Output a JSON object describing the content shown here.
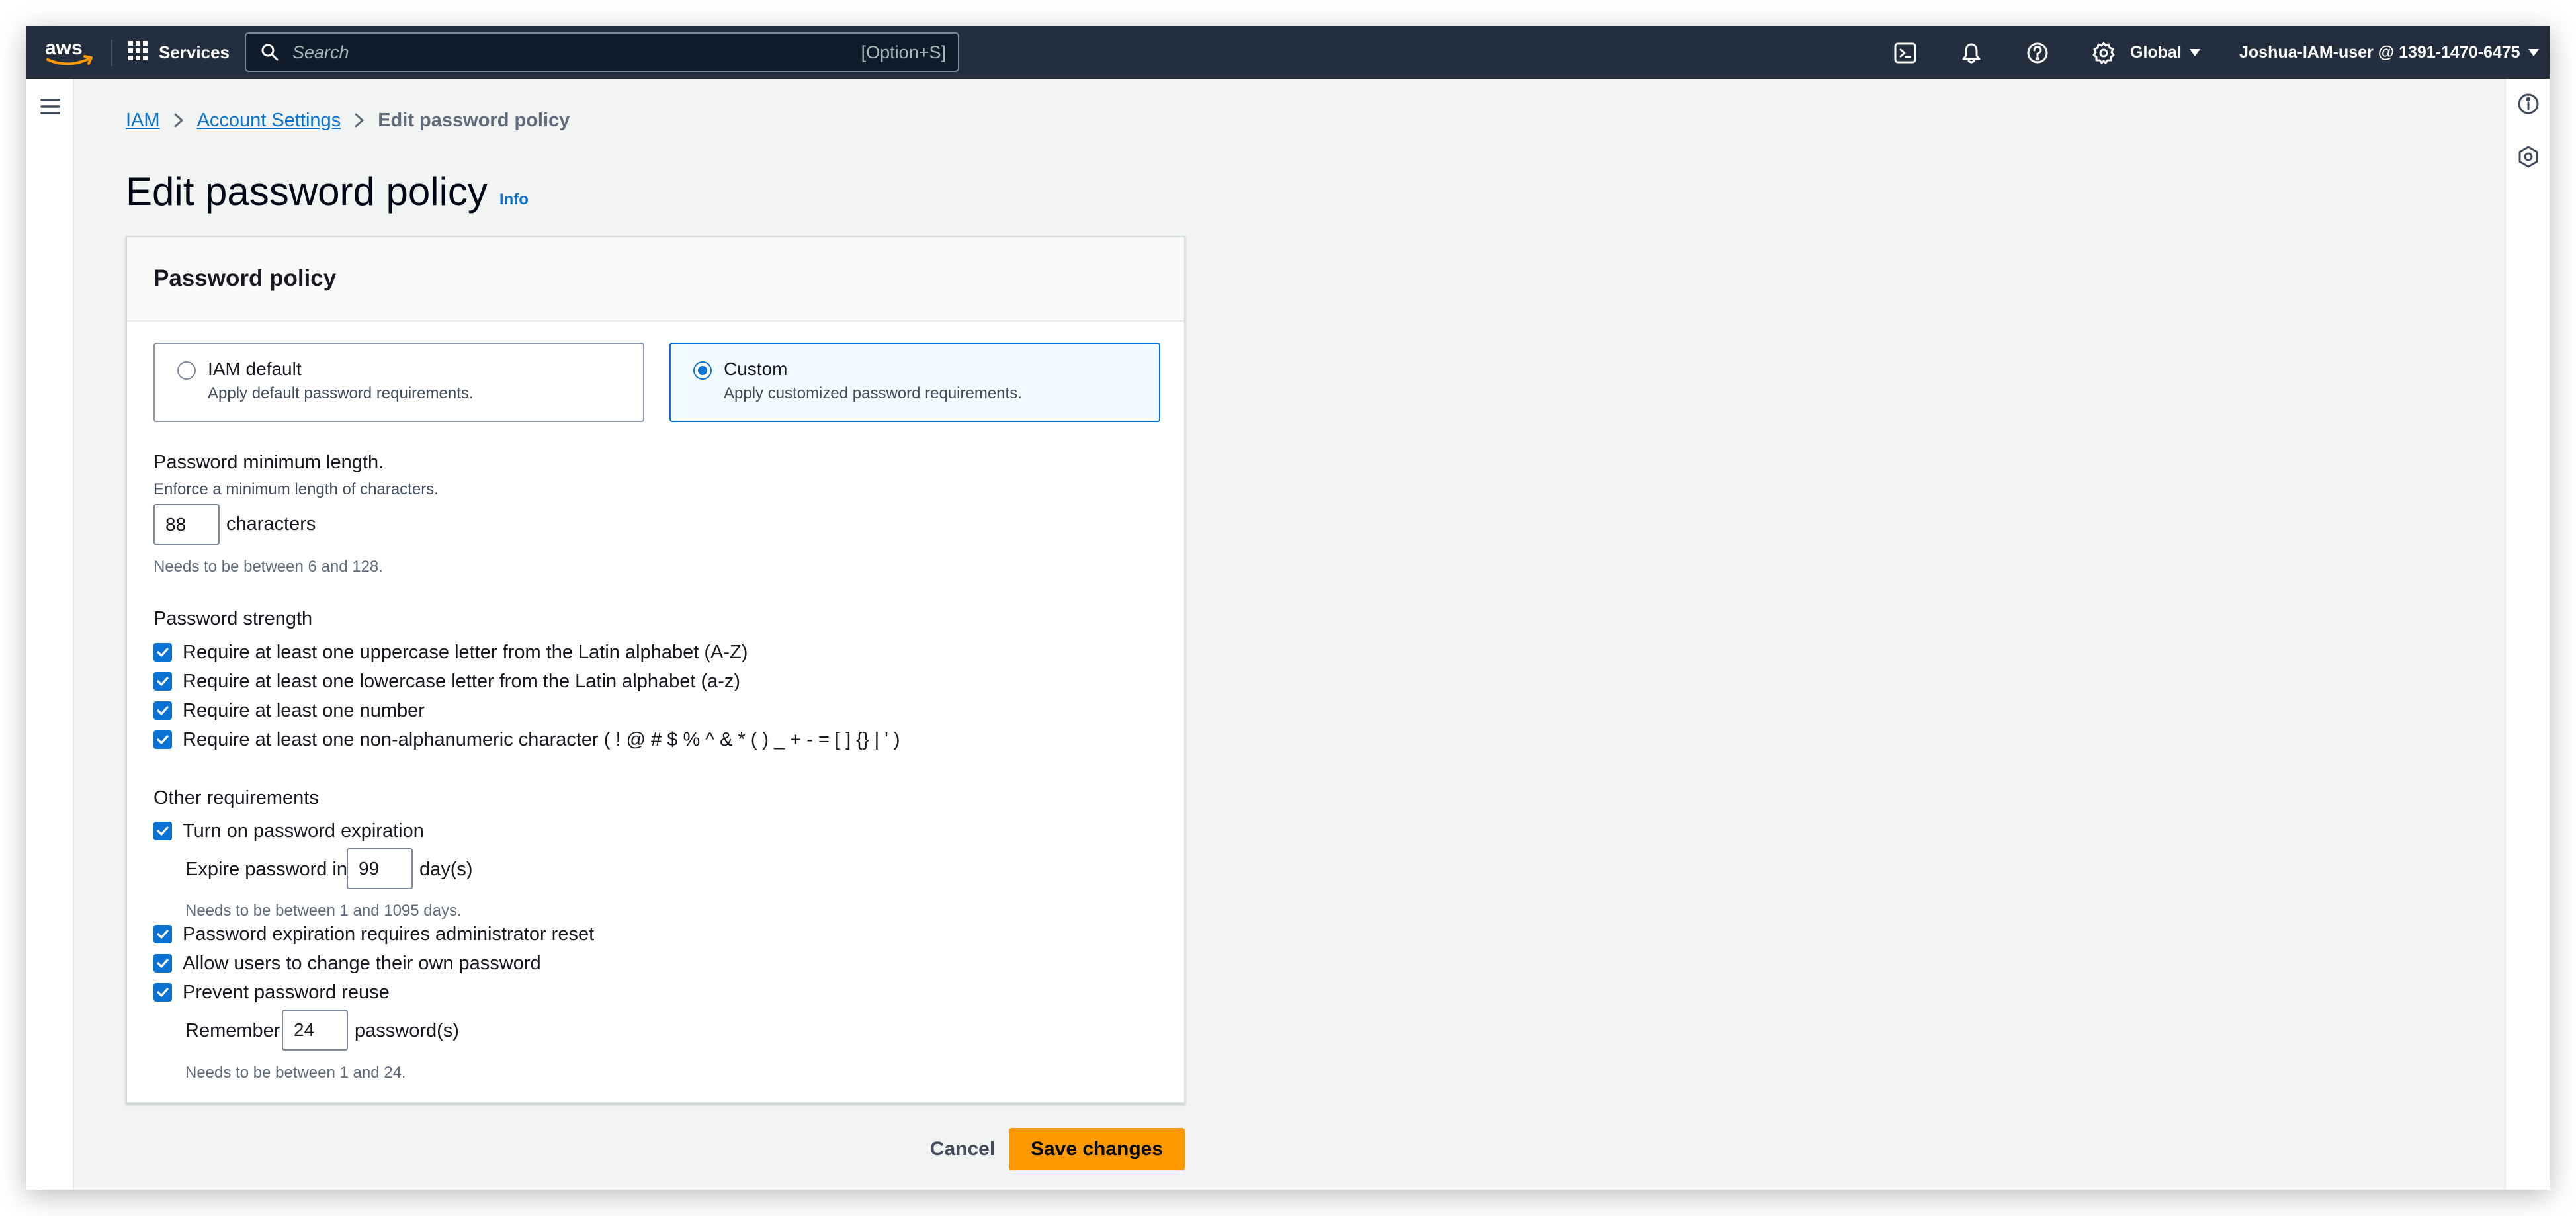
{
  "topnav": {
    "logo_text": "aws",
    "services_label": "Services",
    "search": {
      "placeholder": "Search",
      "shortcut": "[Option+S]"
    },
    "icons": [
      "cloudshell-icon",
      "bell-icon",
      "help-icon",
      "settings-icon"
    ],
    "region_label": "Global",
    "account_label": "Joshua-IAM-user @ 1391-1470-6475"
  },
  "breadcrumb": {
    "items": [
      "IAM",
      "Account Settings"
    ],
    "current": "Edit password policy"
  },
  "page": {
    "title": "Edit password policy",
    "info_label": "Info"
  },
  "policy": {
    "header": "Password policy",
    "options": [
      {
        "title": "IAM default",
        "desc": "Apply default password requirements.",
        "selected": false
      },
      {
        "title": "Custom",
        "desc": "Apply customized password requirements.",
        "selected": true
      }
    ],
    "min_length": {
      "label": "Password minimum length.",
      "desc": "Enforce a minimum length of characters.",
      "value": "88",
      "unit": "characters",
      "hint": "Needs to be between 6 and 128."
    },
    "strength": {
      "title": "Password strength",
      "items": [
        "Require at least one uppercase letter from the Latin alphabet (A-Z)",
        "Require at least one lowercase letter from the Latin alphabet (a-z)",
        "Require at least one number",
        "Require at least one non-alphanumeric character ( ! @ # $ % ^ & * ( ) _ + - = [ ] {} | ' )"
      ]
    },
    "other": {
      "title": "Other requirements",
      "expiration": {
        "label": "Turn on password expiration",
        "prefix": "Expire password in",
        "value": "99",
        "unit": "day(s)",
        "hint": "Needs to be between 1 and 1095 days."
      },
      "admin_reset": "Password expiration requires administrator reset",
      "allow_change": "Allow users to change their own password",
      "prevent_reuse": {
        "label": "Prevent password reuse",
        "prefix": "Remember",
        "value": "24",
        "unit": "password(s)",
        "hint": "Needs to be between 1 and 24."
      }
    }
  },
  "actions": {
    "cancel": "Cancel",
    "save": "Save changes"
  },
  "colors": {
    "nav_bg": "#232f3e",
    "link": "#0972d3",
    "primary_button": "#ff9900",
    "page_bg": "#f2f3f3"
  }
}
